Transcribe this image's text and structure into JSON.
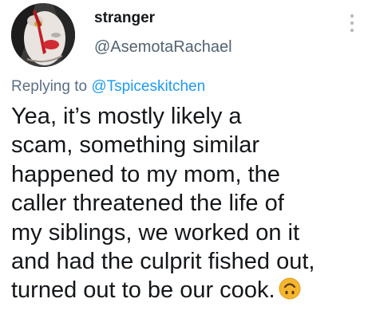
{
  "author": {
    "display_name": "stranger",
    "handle": "@AsemotaRachael",
    "avatar_icon": "clown-face-avatar"
  },
  "reply": {
    "prefix": "Replying to ",
    "mention": "@Tspiceskitchen"
  },
  "tweet": {
    "lines": [
      "Yea, it’s mostly likely a",
      "scam, something similar",
      "happened to my mom, the",
      "caller threatened the life of",
      "my siblings, we worked on it",
      "and had the culprit fished out,",
      "turned out to be our cook."
    ],
    "emoji_icon": "upside-down-face-icon"
  },
  "icons": {
    "more_menu": "vertical-dots-icon"
  },
  "colors": {
    "text_primary": "#14171a",
    "text_secondary": "#536471",
    "link": "#1d9bf0",
    "background": "#ffffff",
    "emoji_fill": "#f5b52e"
  }
}
